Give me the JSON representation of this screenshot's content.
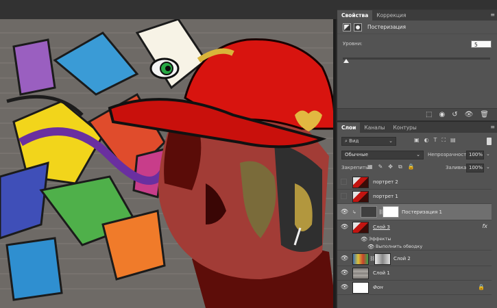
{
  "properties": {
    "tabs": [
      {
        "label": "Свойства"
      },
      {
        "label": "Коррекция"
      }
    ],
    "title": "Постеризация",
    "levels_label": "Уровни:",
    "levels_value": "5",
    "icons": [
      "clip-to-layer-icon",
      "view-previous-icon",
      "reset-icon",
      "visibility-icon",
      "trash-icon"
    ]
  },
  "layers_panel": {
    "tabs": [
      {
        "label": "Слои"
      },
      {
        "label": "Каналы"
      },
      {
        "label": "Контуры"
      }
    ],
    "filter_kind": "Вид",
    "blend_mode": "Обычные",
    "opacity_label": "Непрозрачность:",
    "opacity_value": "100%",
    "lock_label": "Закрепить:",
    "fill_label": "Заливка:",
    "fill_value": "100%",
    "layers": [
      {
        "name": "портрет 2",
        "visible": false
      },
      {
        "name": "портрет 1",
        "visible": false
      },
      {
        "name": "Постеризация 1",
        "visible": true,
        "selected": true
      },
      {
        "name": "Слой 3",
        "visible": true,
        "fx": "fx"
      },
      {
        "effects_label": "Эффекты",
        "stroke_label": "Выполнить обводку"
      },
      {
        "name": "Слой 2",
        "visible": true
      },
      {
        "name": "Слой 1",
        "visible": true
      },
      {
        "name": "Фон",
        "visible": true,
        "locked": true
      }
    ]
  },
  "colors": {
    "cap_red": "#d8140f",
    "skin_shadow": "#5a0c08",
    "skin_mid": "#a33d37",
    "panel_bg": "#535353"
  }
}
